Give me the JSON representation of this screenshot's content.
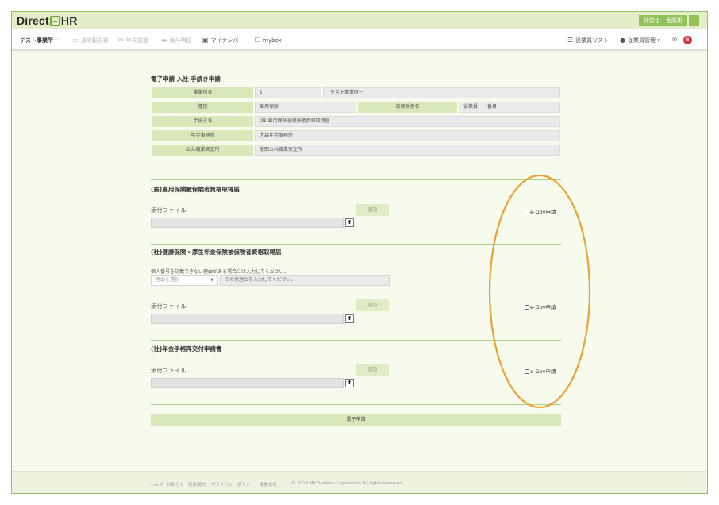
{
  "header": {
    "logo_left": "Direct",
    "logo_right": "HR",
    "user_button": "社労士　香認用",
    "user_caret": "⌄"
  },
  "nav": {
    "office": "テスト事業所ー",
    "items": [
      {
        "label": "通常報告書",
        "icon": "document-icon"
      },
      {
        "label": "年末調整",
        "icon": "mail-icon"
      },
      {
        "label": "給与明細",
        "icon": "card-icon"
      },
      {
        "label": "マイナンバー",
        "icon": "id-card-icon"
      },
      {
        "label": "mybox",
        "icon": "inbox-icon"
      }
    ],
    "employee_list": "従業員リスト",
    "employee_mgmt": "従業員管理 ▾",
    "notif_count": "8"
  },
  "page": {
    "title": "電子申請 入社 手続き申請"
  },
  "info": {
    "office_label": "事業所名",
    "office_code": "1",
    "office_name": "テスト事業所ー",
    "type_label": "種別",
    "type_value": "雇用保険",
    "insured_label": "被保険者名",
    "insured_value": "従業員　一番目",
    "procedure_label": "手続き名",
    "procedure_value": "(雇)雇用保険被保険者資格取得届",
    "pension_label": "年金事務所",
    "pension_value": "大森年金事務所",
    "hellowork_label": "公共職業安定所",
    "hellowork_value": "飯田公共職業安定所"
  },
  "sections": [
    {
      "title": "(雇)雇用保険被保険者資格取得届",
      "attach_label": "添付ファイル",
      "add_label": "追加",
      "egov_label": "e-Gov申請"
    },
    {
      "title": "(社)健康保険・厚生年金保険被保険者資格取得届",
      "note": "個人番号を記載できない理由がある場合には入力してください。",
      "reason_placeholder": "理由を選択",
      "reason_input_placeholder": "その他理由を入力してください。",
      "attach_label": "添付ファイル",
      "add_label": "追加",
      "egov_label": "e-Gov申請"
    },
    {
      "title": "(社)年金手帳再交付申請書",
      "attach_label": "添付ファイル",
      "add_label": "追加",
      "egov_label": "e-Gov申請"
    }
  ],
  "submit_label": "電子申請",
  "footer": {
    "links": [
      "ヘルプ",
      "お知らせ",
      "利用規約",
      "プライバシーポリシー",
      "運営会社"
    ],
    "copyright": "© 2018 MK System Corporation All rights reserved."
  },
  "colors": {
    "accent": "#93c25a",
    "annotation": "#f0a030"
  }
}
